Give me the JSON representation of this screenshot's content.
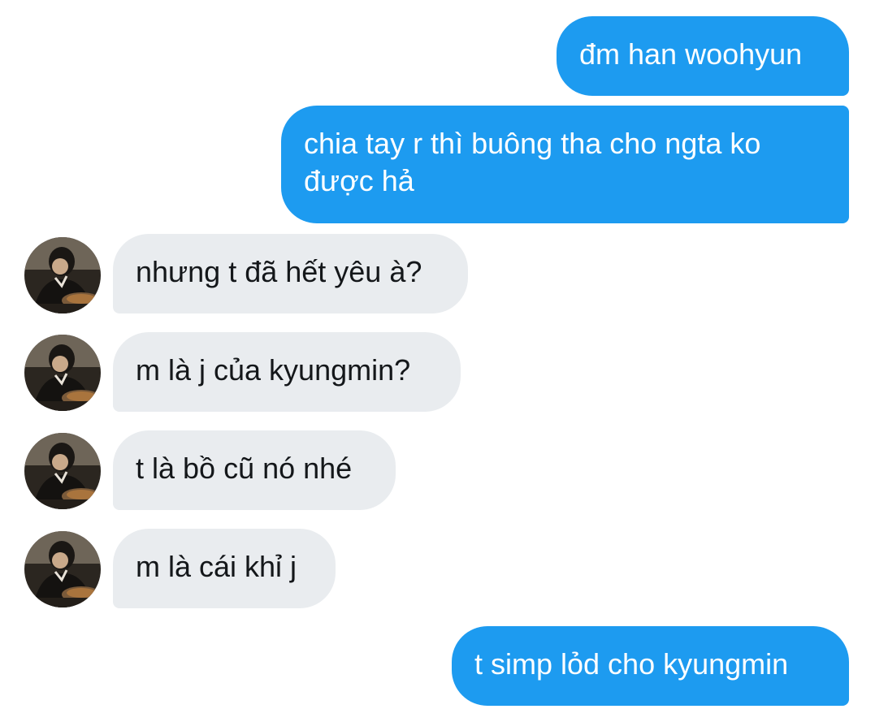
{
  "conversation": {
    "messages": [
      {
        "direction": "outgoing",
        "text": "đm han woohyun"
      },
      {
        "direction": "outgoing",
        "text": "chia tay r thì buông tha cho ngta ko được hả"
      },
      {
        "direction": "incoming",
        "text": "nhưng t đã hết yêu à?"
      },
      {
        "direction": "incoming",
        "text": "m là j của kyungmin?"
      },
      {
        "direction": "incoming",
        "text": "t là bồ cũ nó nhé"
      },
      {
        "direction": "incoming",
        "text": "m là cái khỉ j"
      },
      {
        "direction": "outgoing",
        "text": "t simp lỏd cho kyungmin"
      }
    ]
  },
  "colors": {
    "outgoing_bubble": "#1d9bf0",
    "incoming_bubble": "#e9ecef",
    "outgoing_text": "#ffffff",
    "incoming_text": "#14171a"
  },
  "icons": {
    "contact_avatar": "user-photo-avatar"
  }
}
